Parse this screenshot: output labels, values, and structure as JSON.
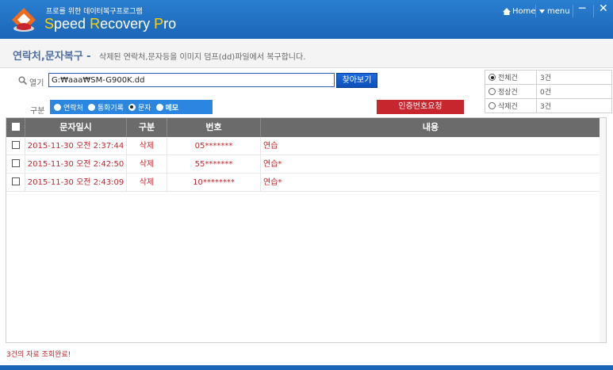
{
  "app": {
    "subtitle": "프로를 위한 데이터복구프로그램",
    "title_s": "S",
    "title_rest1": "peed ",
    "title_r": "R",
    "title_rest2": "ecovery ",
    "title_p": "P",
    "title_rest3": "ro",
    "home_label": "Home",
    "menu_label": "menu",
    "minimize_label": "─",
    "close_label": "✕"
  },
  "section": {
    "title": "연락처,문자복구 -",
    "description": "삭제된 연락처,문자등을 이미지 덤프(dd)파일에서 복구합니다."
  },
  "open": {
    "label": "열기",
    "path_value": "G:₩aaa₩SM-G900K.dd",
    "browse_label": "찾아보기"
  },
  "stats": [
    {
      "label": "전체건",
      "value": "3건",
      "selected": true
    },
    {
      "label": "정상건",
      "value": "0건",
      "selected": false
    },
    {
      "label": "삭제건",
      "value": "3건",
      "selected": false
    }
  ],
  "category": {
    "label": "구분",
    "options": [
      {
        "label": "연락처",
        "selected": false
      },
      {
        "label": "통화기록",
        "selected": false
      },
      {
        "label": "문자",
        "selected": true
      },
      {
        "label": "메모",
        "selected": false
      }
    ],
    "auth_button": "인증번호요청"
  },
  "grid": {
    "headers": {
      "datetime": "문자일시",
      "type": "구분",
      "number": "번호",
      "content": "내용"
    },
    "rows": [
      {
        "datetime": "2015-11-30 오전 2:37:44",
        "type": "삭제",
        "number": "05*******",
        "content": "연습"
      },
      {
        "datetime": "2015-11-30 오전 2:42:50",
        "type": "삭제",
        "number": "55*******",
        "content": "연습*"
      },
      {
        "datetime": "2015-11-30 오전 2:43:09",
        "type": "삭제",
        "number": "10********",
        "content": "연습*"
      }
    ]
  },
  "status_text": "3건의 자료 조회완료!",
  "colors": {
    "titlebar": "#1b65b7",
    "accent_red": "#c0262e",
    "category_blue": "#2a86e0"
  }
}
